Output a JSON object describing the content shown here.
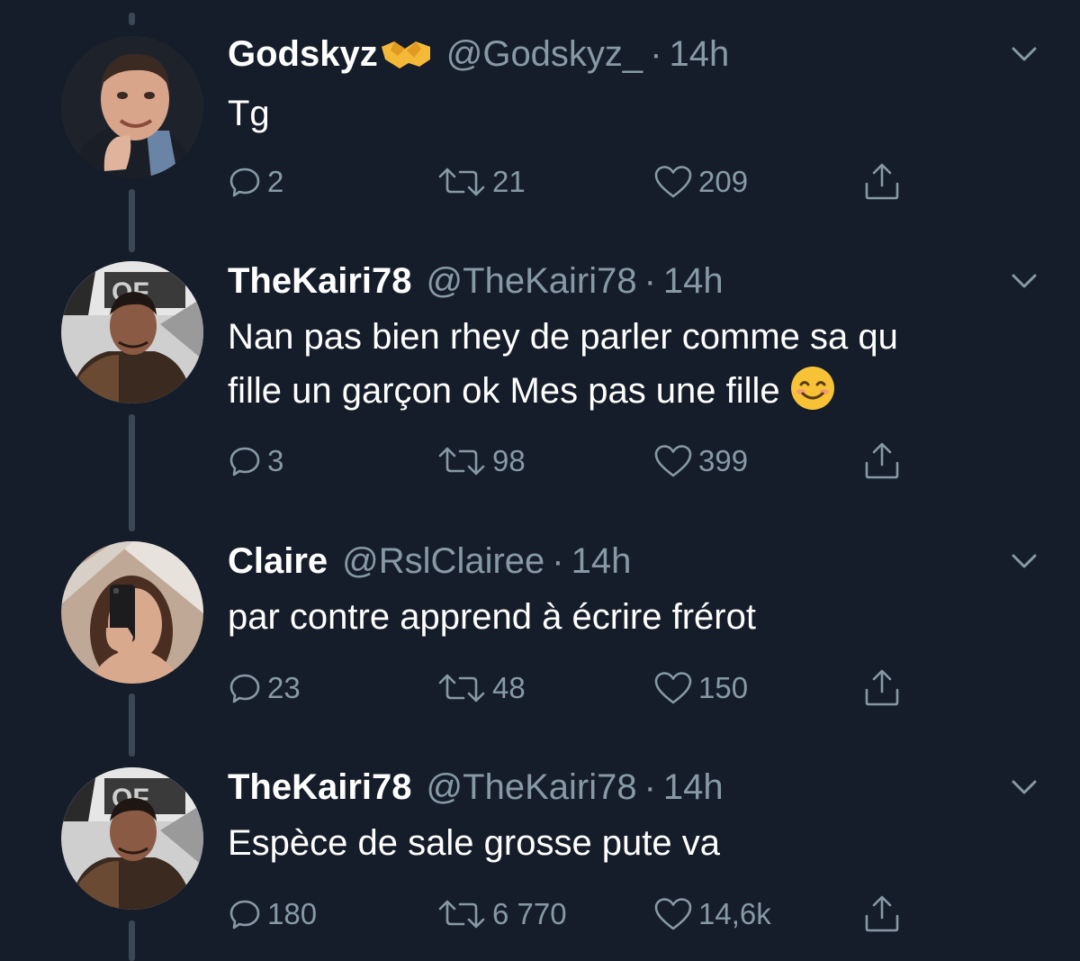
{
  "tweets": [
    {
      "display_name": "Godskyz",
      "badge_icon": "handshake-emoji",
      "handle": "@Godskyz_",
      "separator": "·",
      "time": "14h",
      "lines": [
        "Tg"
      ],
      "replies": "2",
      "retweets": "21",
      "likes": "209"
    },
    {
      "display_name": "TheKairi78",
      "handle": "@TheKairi78",
      "separator": "·",
      "time": "14h",
      "lines": [
        "Nan pas bien rhey de parler comme sa qu",
        "fille un garçon ok Mes pas une fille"
      ],
      "trailing_emoji": "smiling-face-emoji",
      "replies": "3",
      "retweets": "98",
      "likes": "399"
    },
    {
      "display_name": "Claire",
      "handle": "@RslClairee",
      "separator": "·",
      "time": "14h",
      "lines": [
        "par contre apprend à écrire frérot"
      ],
      "replies": "23",
      "retweets": "48",
      "likes": "150"
    },
    {
      "display_name": "TheKairi78",
      "handle": "@TheKairi78",
      "separator": "·",
      "time": "14h",
      "lines": [
        "Espèce de sale grosse pute va"
      ],
      "replies": "180",
      "retweets": "6 770",
      "likes": "14,6k"
    }
  ],
  "colors": {
    "background": "#151d2a",
    "text": "#ffffff",
    "muted": "#8899a6",
    "thread_line": "#3b4755"
  }
}
